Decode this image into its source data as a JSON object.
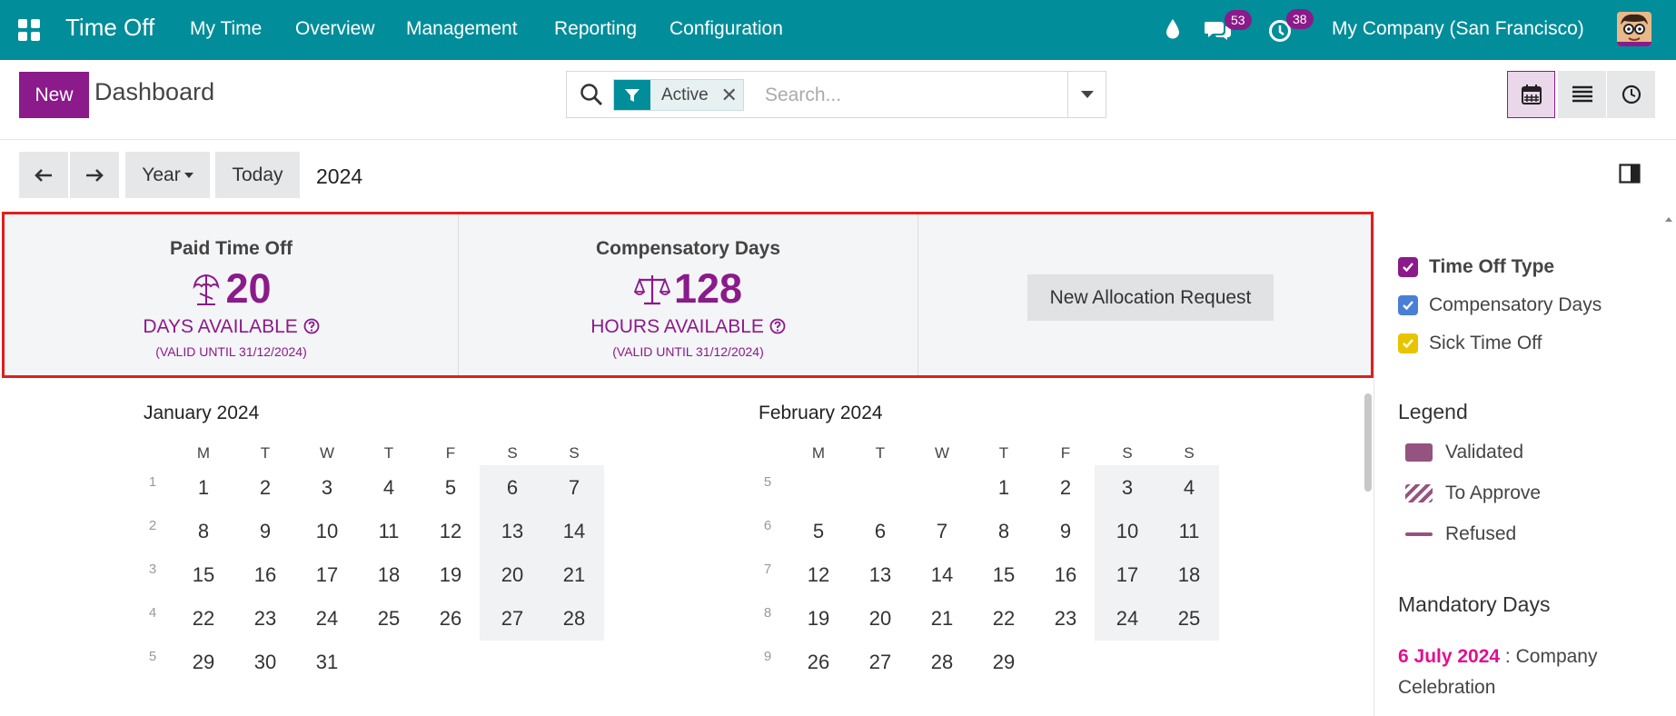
{
  "topbar": {
    "app_name": "Time Off",
    "menu": [
      "My Time",
      "Overview",
      "Management",
      "Reporting",
      "Configuration"
    ],
    "messages_count": "53",
    "activities_count": "38",
    "company": "My Company (San Francisco)"
  },
  "control": {
    "new_label": "New",
    "title": "Dashboard",
    "facet_label": "Active",
    "search_placeholder": "Search..."
  },
  "nav": {
    "scale_label": "Year",
    "today_label": "Today",
    "year": "2024"
  },
  "summary": {
    "cards": [
      {
        "title": "Paid Time Off",
        "value": "20",
        "unit": "DAYS AVAILABLE",
        "valid": "(VALID UNTIL 31/12/2024)",
        "icon": "beach-umbrella-icon"
      },
      {
        "title": "Compensatory Days",
        "value": "128",
        "unit": "HOURS AVAILABLE",
        "valid": "(VALID UNTIL 31/12/2024)",
        "icon": "balance-scale-icon"
      }
    ],
    "allocation_button": "New Allocation Request"
  },
  "calendar": {
    "weekday_labels": [
      "M",
      "T",
      "W",
      "T",
      "F",
      "S",
      "S"
    ],
    "months": [
      {
        "title": "January 2024",
        "weeks": [
          {
            "wk": "1",
            "days": [
              "1",
              "2",
              "3",
              "4",
              "5",
              "6",
              "7"
            ]
          },
          {
            "wk": "2",
            "days": [
              "8",
              "9",
              "10",
              "11",
              "12",
              "13",
              "14"
            ]
          },
          {
            "wk": "3",
            "days": [
              "15",
              "16",
              "17",
              "18",
              "19",
              "20",
              "21"
            ]
          },
          {
            "wk": "4",
            "days": [
              "22",
              "23",
              "24",
              "25",
              "26",
              "27",
              "28"
            ]
          },
          {
            "wk": "5",
            "days": [
              "29",
              "30",
              "31",
              "",
              "",
              "",
              ""
            ]
          }
        ]
      },
      {
        "title": "February 2024",
        "weeks": [
          {
            "wk": "5",
            "days": [
              "",
              "",
              "",
              "1",
              "2",
              "3",
              "4"
            ]
          },
          {
            "wk": "6",
            "days": [
              "5",
              "6",
              "7",
              "8",
              "9",
              "10",
              "11"
            ]
          },
          {
            "wk": "7",
            "days": [
              "12",
              "13",
              "14",
              "15",
              "16",
              "17",
              "18"
            ]
          },
          {
            "wk": "8",
            "days": [
              "19",
              "20",
              "21",
              "22",
              "23",
              "24",
              "25"
            ]
          },
          {
            "wk": "9",
            "days": [
              "26",
              "27",
              "28",
              "29",
              "",
              "",
              ""
            ]
          }
        ]
      }
    ]
  },
  "sidebar": {
    "filters": [
      {
        "label": "Time Off Type",
        "color": "#8b1a8b",
        "bold": true
      },
      {
        "label": "Compensatory Days",
        "color": "#4a7fd6",
        "bold": false
      },
      {
        "label": "Sick Time Off",
        "color": "#e8c400",
        "bold": false
      }
    ],
    "legend_title": "Legend",
    "legend": [
      {
        "label": "Validated",
        "style": "solid"
      },
      {
        "label": "To Approve",
        "style": "striped"
      },
      {
        "label": "Refused",
        "style": "line"
      }
    ],
    "mandatory_title": "Mandatory Days",
    "mandatory_date": "6 July 2024",
    "mandatory_sep": " : ",
    "mandatory_name_1": "Company",
    "mandatory_name_2": "Celebration"
  },
  "colors": {
    "brand": "#018d99",
    "primary": "#8b1a8b",
    "highlight_border": "#e01e1e",
    "mandatory": "#e0108f"
  }
}
